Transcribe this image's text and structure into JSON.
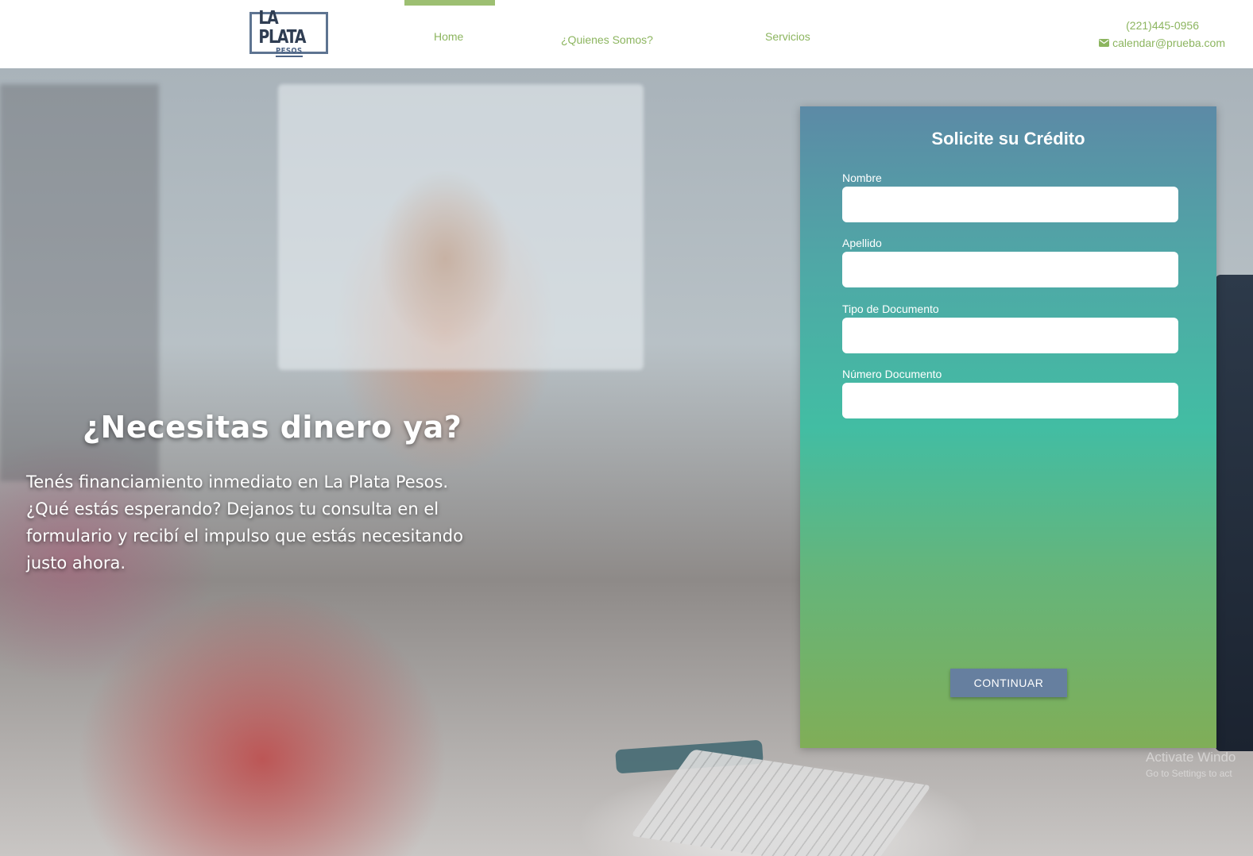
{
  "header": {
    "logo": {
      "top": "LA PLATA",
      "bottom": "PESOS"
    },
    "nav": [
      {
        "label": "Home"
      },
      {
        "label": "¿Quienes Somos?"
      },
      {
        "label": "Servicios"
      }
    ],
    "contact": {
      "phone": "(221)445-0956",
      "email": "calendar@prueba.com"
    }
  },
  "hero": {
    "title": "¿Necesitas dinero ya?",
    "paragraph_1": "Tenés financiamiento inmediato en La Plata Pesos.",
    "paragraph_2": "¿Qué estás esperando? Dejanos tu consulta en el formulario y recibí el impulso que estás necesitando justo ahora."
  },
  "form": {
    "title": "Solicite su Crédito",
    "fields": [
      {
        "label": "Nombre",
        "value": ""
      },
      {
        "label": "Apellido",
        "value": ""
      },
      {
        "label": "Tipo de Documento",
        "value": ""
      },
      {
        "label": "Número Documento",
        "value": ""
      }
    ],
    "submit_label": "CONTINUAR"
  },
  "watermark": {
    "line1": "Activate Windo",
    "line2": "Go to Settings to act"
  },
  "colors": {
    "accent_green": "#8cb55f",
    "nav_active": "#9dbf72",
    "logo_blue": "#5e7491",
    "button": "#667f9f",
    "card_top": "#5c8aa6",
    "card_bottom": "#80ae57"
  }
}
